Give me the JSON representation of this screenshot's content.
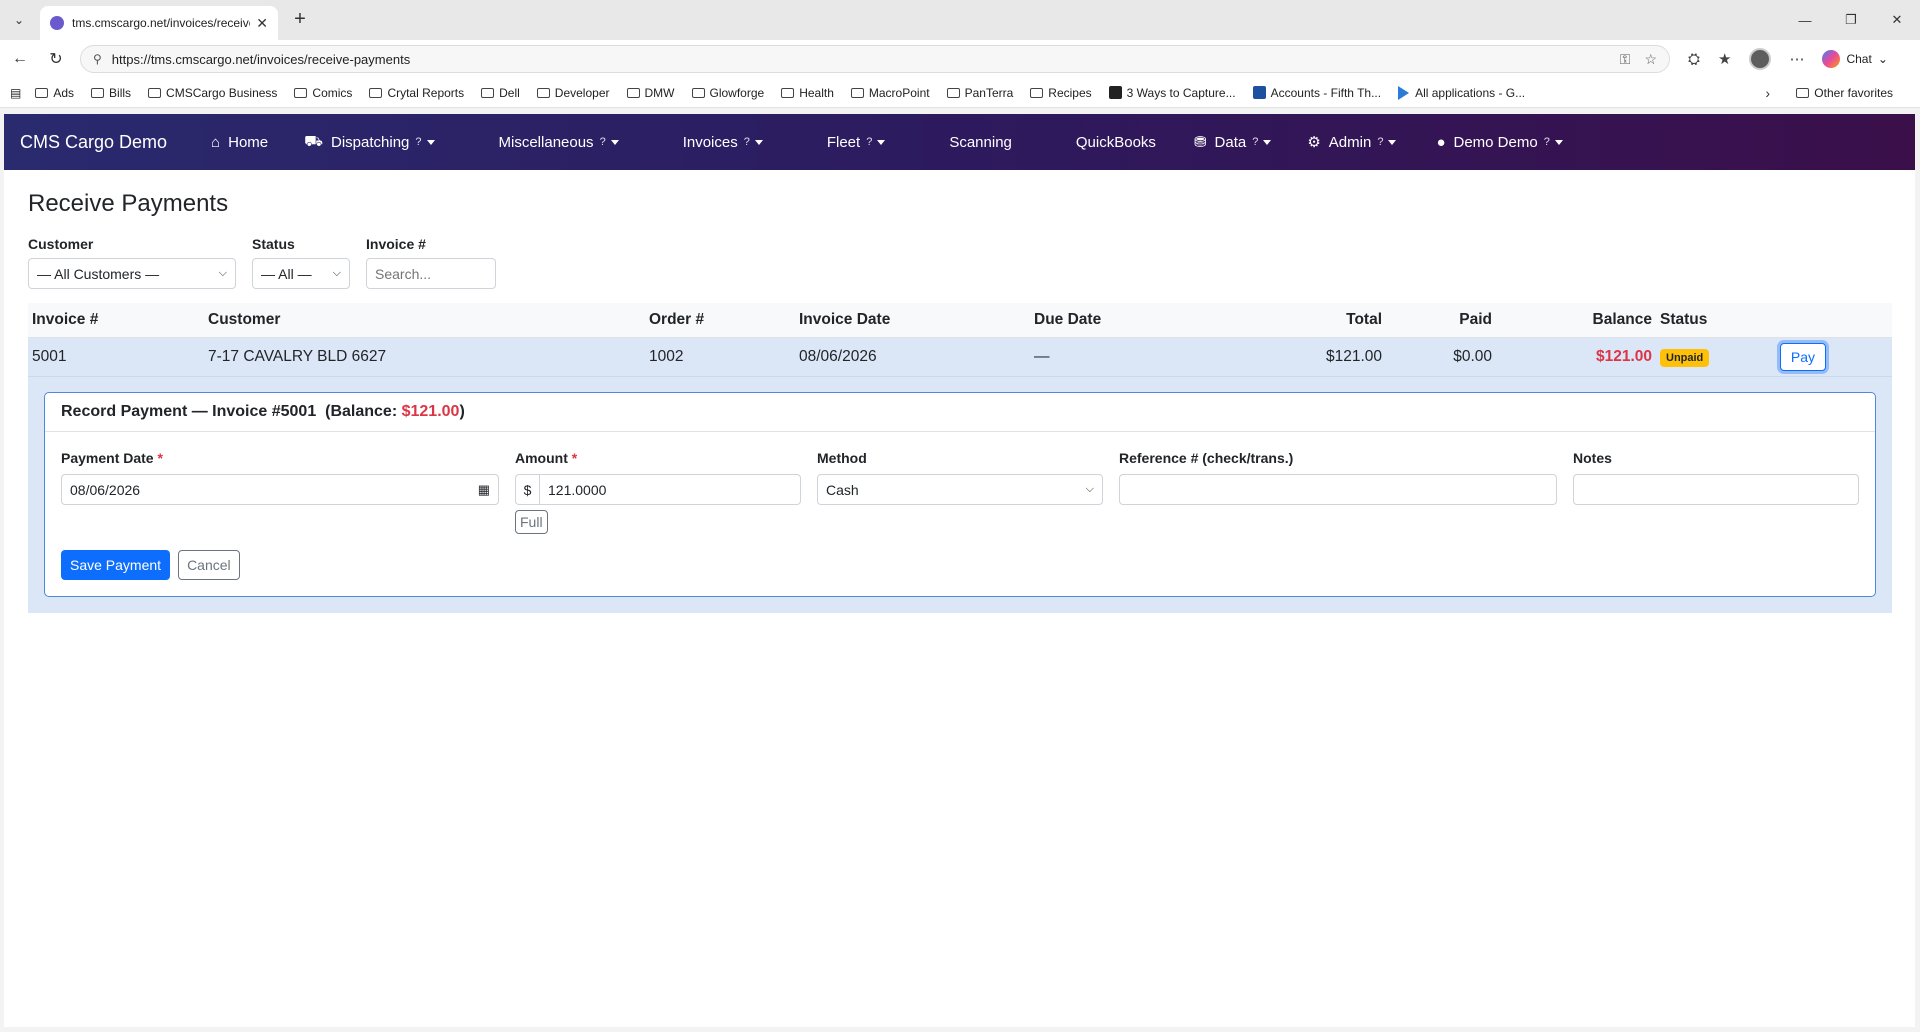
{
  "browser": {
    "tab_title": "tms.cmscargo.net/invoices/receive-",
    "url": "https://tms.cmscargo.net/invoices/receive-payments",
    "chat_label": "Chat",
    "bookmarks": [
      "Ads",
      "Bills",
      "CMSCargo Business",
      "Comics",
      "Crytal Reports",
      "Dell",
      "Developer",
      "DMW",
      "Glowforge",
      "Health",
      "MacroPoint",
      "PanTerra",
      "Recipes",
      "3 Ways to Capture...",
      "Accounts - Fifth Th...",
      "All applications - G..."
    ],
    "other_favorites": "Other favorites"
  },
  "nav": {
    "brand": "CMS Cargo Demo",
    "home": "Home",
    "dispatching": "Dispatching",
    "miscellaneous": "Miscellaneous",
    "invoices": "Invoices",
    "fleet": "Fleet",
    "scanning": "Scanning",
    "quickbooks": "QuickBooks",
    "data": "Data",
    "admin": "Admin",
    "user": "Demo Demo",
    "help_mark": "?"
  },
  "page": {
    "title": "Receive Payments"
  },
  "filters": {
    "customer_label": "Customer",
    "customer_value": "— All Customers —",
    "status_label": "Status",
    "status_value": "— All —",
    "invoice_label": "Invoice #",
    "invoice_placeholder": "Search..."
  },
  "table": {
    "headers": [
      "Invoice #",
      "Customer",
      "Order #",
      "Invoice Date",
      "Due Date",
      "Total",
      "Paid",
      "Balance",
      "Status"
    ],
    "row": {
      "invoice": "5001",
      "customer": "7-17 CAVALRY BLD 6627",
      "order": "1002",
      "invoice_date": "08/06/2026",
      "due_date": "—",
      "total": "$121.00",
      "paid": "$0.00",
      "balance": "$121.00",
      "status": "Unpaid",
      "pay_label": "Pay"
    }
  },
  "payment_form": {
    "title_prefix": "Record Payment — Invoice #5001  (Balance: ",
    "title_balance": "$121.00",
    "title_suffix": ")",
    "date_label": "Payment Date",
    "date_value": "08/06/2026",
    "amount_label": "Amount",
    "currency": "$",
    "amount_value": "121.0000",
    "full_label": "Full",
    "method_label": "Method",
    "method_value": "Cash",
    "reference_label": "Reference # (check/trans.)",
    "reference_value": "",
    "notes_label": "Notes",
    "notes_value": "",
    "required_mark": "*",
    "save_label": "Save Payment",
    "cancel_label": "Cancel"
  }
}
